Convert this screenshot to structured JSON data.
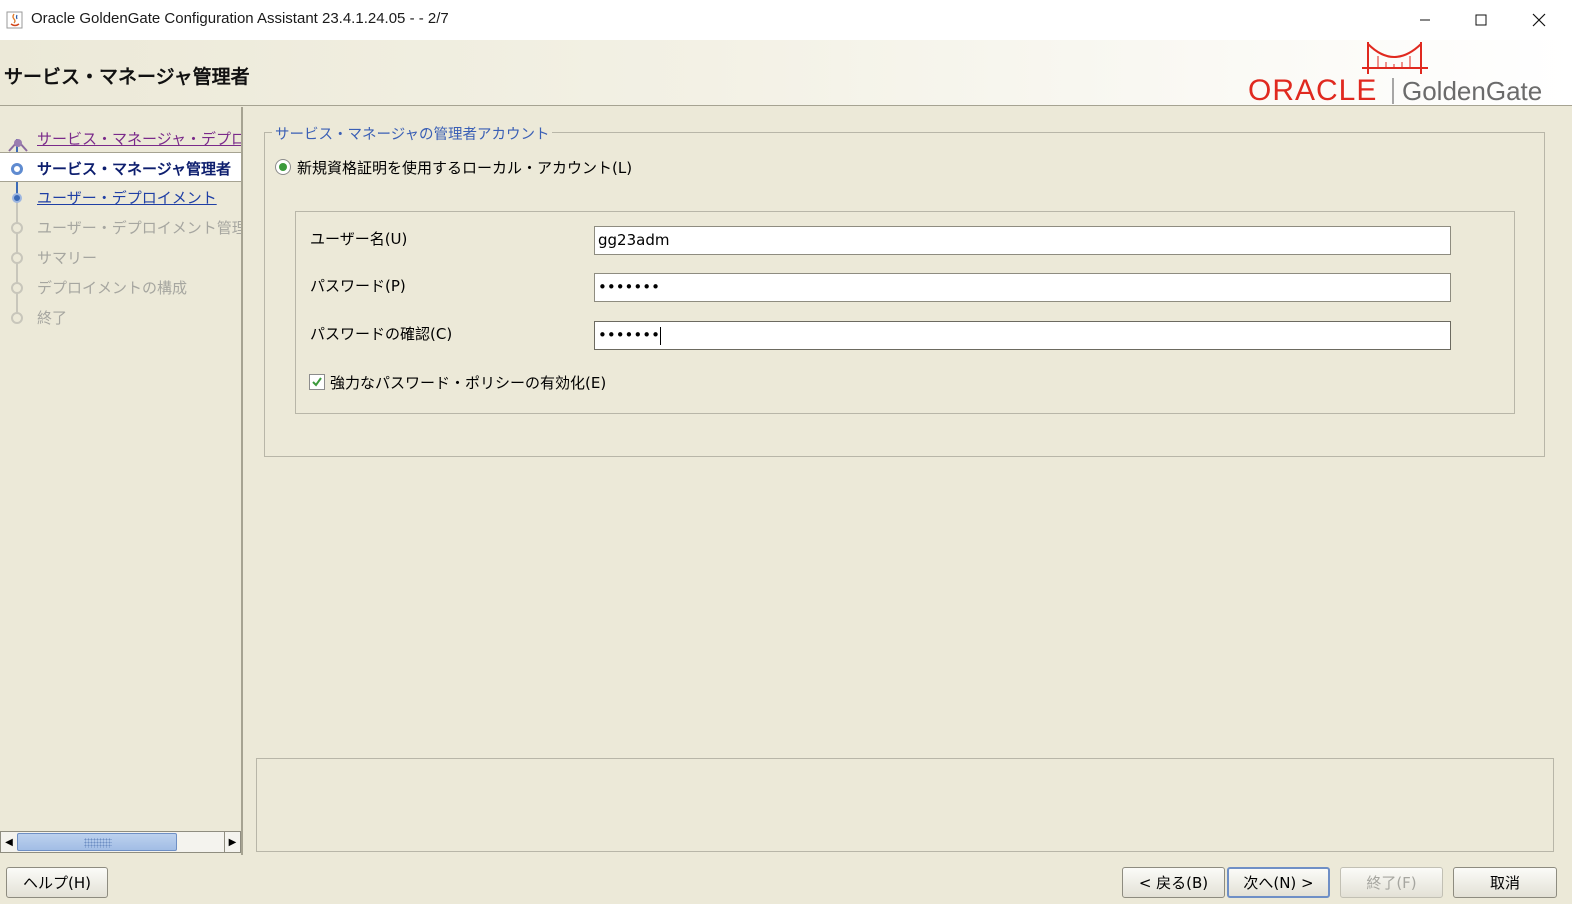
{
  "window": {
    "title": "Oracle GoldenGate Configuration Assistant 23.4.1.24.05 -  - 2/7"
  },
  "header": {
    "page_title": "サービス・マネージャ管理者",
    "logo_oracle": "ORACLE",
    "logo_product": "GoldenGate",
    "brand_color": "#e0291f"
  },
  "nav": {
    "items": [
      {
        "label": "サービス・マネージャ・デプロイメント",
        "state": "visited"
      },
      {
        "label": "サービス・マネージャ管理者",
        "state": "current"
      },
      {
        "label": "ユーザー・デプロイメント",
        "state": "link"
      },
      {
        "label": "ユーザー・デプロイメント管理者",
        "state": "disabled"
      },
      {
        "label": "サマリー",
        "state": "disabled"
      },
      {
        "label": "デプロイメントの構成",
        "state": "disabled"
      },
      {
        "label": "終了",
        "state": "disabled"
      }
    ]
  },
  "account_group": {
    "title": "サービス・マネージャの管理者アカウント",
    "radio_label": "新規資格証明を使用するローカル・アカウント(L)",
    "radio_selected": true,
    "fields": {
      "username": {
        "label": "ユーザー名(U)",
        "value": "gg23adm"
      },
      "password": {
        "label": "パスワード(P)",
        "value": "•••••••"
      },
      "confirm_password": {
        "label": "パスワードの確認(C)",
        "value": "•••••••"
      }
    },
    "strong_policy": {
      "label": "強力なパスワード・ポリシーの有効化(E)",
      "checked": true
    }
  },
  "buttons": {
    "help": "ヘルプ(H)",
    "back": "< 戻る(B)",
    "next": "次へ(N) >",
    "finish": "終了(F)",
    "cancel": "取消"
  }
}
